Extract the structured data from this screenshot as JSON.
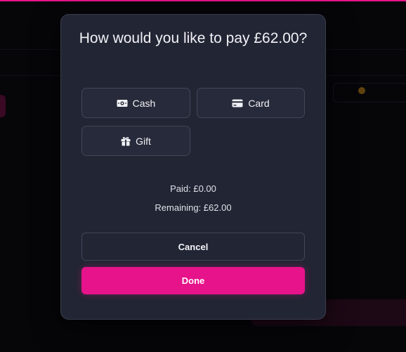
{
  "modal": {
    "title": "How would you like to pay £62.00?",
    "methods": [
      {
        "label": "Cash",
        "icon": "cash-icon"
      },
      {
        "label": "Card",
        "icon": "credit-card-icon"
      },
      {
        "label": "Gift",
        "icon": "gift-icon"
      }
    ],
    "paid_text": "Paid: £0.00",
    "remaining_text": "Remaining: £62.00",
    "cancel_label": "Cancel",
    "done_label": "Done"
  },
  "colors": {
    "accent": "#e6138a",
    "modal_bg": "#222534",
    "button_bg": "#272a3a",
    "page_bg": "#060609"
  }
}
